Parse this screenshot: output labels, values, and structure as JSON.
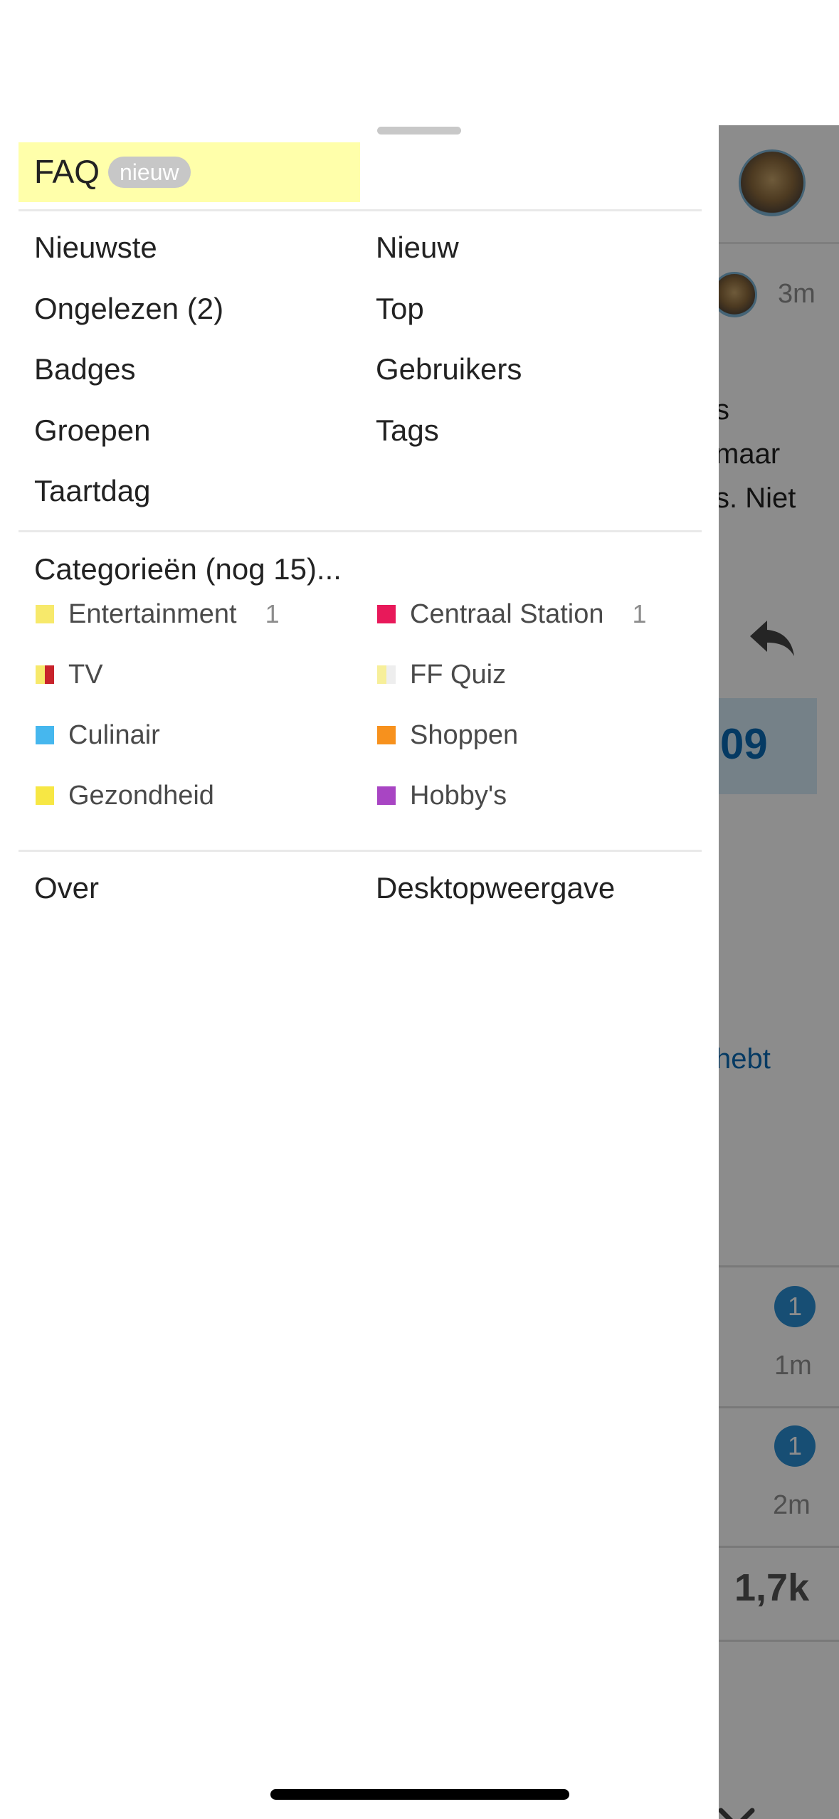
{
  "menu": {
    "faq": {
      "label": "FAQ",
      "badge": "nieuw"
    },
    "nav_left": [
      "Nieuwste",
      "Ongelezen (2)",
      "Badges",
      "Groepen",
      "Taartdag"
    ],
    "nav_right": [
      "Nieuw",
      "Top",
      "Gebruikers",
      "Tags"
    ],
    "categories_heading": "Categorieën (nog 15)...",
    "categories": [
      {
        "name": "Entertainment",
        "count": "1",
        "color": "#f7e96b"
      },
      {
        "name": "Centraal Station",
        "count": "1",
        "color": "#e8195a"
      },
      {
        "name": "TV",
        "count": "",
        "color": "#f7e96b",
        "color2": "#c8232b"
      },
      {
        "name": "FF Quiz",
        "count": "",
        "color": "#f7ef9a",
        "color2": "#eeeeee"
      },
      {
        "name": "Culinair",
        "count": "",
        "color": "#46b7ee"
      },
      {
        "name": "Shoppen",
        "count": "",
        "color": "#f7911d"
      },
      {
        "name": "Gezondheid",
        "count": "",
        "color": "#f7e744"
      },
      {
        "name": "Hobby's",
        "count": "",
        "color": "#a845c3"
      }
    ],
    "footer": {
      "about": "Over",
      "desktop": "Desktopweergave"
    }
  },
  "background": {
    "post_age": "3m",
    "text_lines": [
      "s",
      "maar",
      "s. Niet"
    ],
    "blue_box_value": "09",
    "link_fragment": "hebt",
    "topics": [
      {
        "badge": "1",
        "age": "1m"
      },
      {
        "badge": "1",
        "age": "2m"
      }
    ],
    "stat": "1,7k"
  }
}
